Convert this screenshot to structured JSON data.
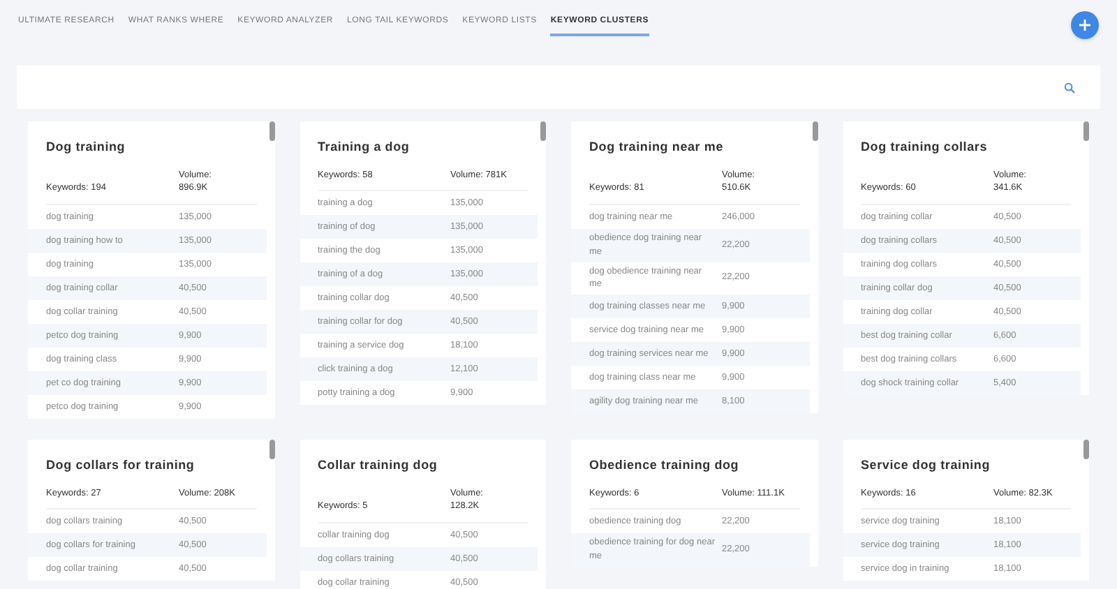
{
  "tabs": [
    {
      "label": "ULTIMATE RESEARCH",
      "selected": false
    },
    {
      "label": "WHAT RANKS WHERE",
      "selected": false
    },
    {
      "label": "KEYWORD ANALYZER",
      "selected": false
    },
    {
      "label": "LONG TAIL KEYWORDS",
      "selected": false
    },
    {
      "label": "KEYWORD LISTS",
      "selected": false
    },
    {
      "label": "KEYWORD CLUSTERS",
      "selected": true
    }
  ],
  "clusters": [
    {
      "title": "Dog training",
      "keywords": "Keywords: 194",
      "volume": "Volume: 896.9K",
      "scrollable": true,
      "rows": [
        [
          "dog training",
          "135,000"
        ],
        [
          "dog training how to",
          "135,000"
        ],
        [
          "dog training",
          "135,000"
        ],
        [
          "dog training collar",
          "40,500"
        ],
        [
          "dog collar training",
          "40,500"
        ],
        [
          "petco dog training",
          "9,900"
        ],
        [
          "dog training class",
          "9,900"
        ],
        [
          "pet co dog training",
          "9,900"
        ],
        [
          "petco dog training",
          "9,900"
        ]
      ]
    },
    {
      "title": "Training a dog",
      "keywords": "Keywords: 58",
      "volume": "Volume: 781K",
      "scrollable": true,
      "rows": [
        [
          "training a dog",
          "135,000"
        ],
        [
          "training of dog",
          "135,000"
        ],
        [
          "training the dog",
          "135,000"
        ],
        [
          "training of a dog",
          "135,000"
        ],
        [
          "training collar dog",
          "40,500"
        ],
        [
          "training collar for dog",
          "40,500"
        ],
        [
          "training a service dog",
          "18,100"
        ],
        [
          "click training a dog",
          "12,100"
        ],
        [
          "potty training a dog",
          "9,900"
        ]
      ]
    },
    {
      "title": "Dog training near me",
      "keywords": "Keywords: 81",
      "volume": "Volume: 510.6K",
      "scrollable": true,
      "rows": [
        [
          "dog training near me",
          "246,000"
        ],
        [
          "obedience dog training near me",
          "22,200"
        ],
        [
          "dog obedience training near me",
          "22,200"
        ],
        [
          "dog training classes near me",
          "9,900"
        ],
        [
          "service dog training near me",
          "9,900"
        ],
        [
          "dog training services near me",
          "9,900"
        ],
        [
          "dog training class near me",
          "9,900"
        ],
        [
          "agility dog training near me",
          "8,100"
        ]
      ]
    },
    {
      "title": "Dog training collars",
      "keywords": "Keywords: 60",
      "volume": "Volume: 341.6K",
      "scrollable": true,
      "rows": [
        [
          "dog training collar",
          "40,500"
        ],
        [
          "dog training collars",
          "40,500"
        ],
        [
          "training dog collars",
          "40,500"
        ],
        [
          "training collar dog",
          "40,500"
        ],
        [
          "training dog collar",
          "40,500"
        ],
        [
          "best dog training collar",
          "6,600"
        ],
        [
          "best dog training collars",
          "6,600"
        ],
        [
          "dog shock training collar",
          "5,400"
        ]
      ]
    },
    {
      "title": "Dog collars for training",
      "keywords": "Keywords: 27",
      "volume": "Volume: 208K",
      "scrollable": true,
      "rows": [
        [
          "dog collars training",
          "40,500"
        ],
        [
          "dog collars for training",
          "40,500"
        ],
        [
          "dog collar training",
          "40,500"
        ]
      ]
    },
    {
      "title": "Collar training dog",
      "keywords": "Keywords: 5",
      "volume": "Volume: 128.2K",
      "scrollable": false,
      "rows": [
        [
          "collar training dog",
          "40,500"
        ],
        [
          "dog collars training",
          "40,500"
        ],
        [
          "dog collar training",
          "40,500"
        ]
      ]
    },
    {
      "title": "Obedience training dog",
      "keywords": "Keywords: 6",
      "volume": "Volume: 111.1K",
      "scrollable": false,
      "rows": [
        [
          "obedience training dog",
          "22,200"
        ],
        [
          "obedience training for dog near me",
          "22,200"
        ]
      ]
    },
    {
      "title": "Service dog training",
      "keywords": "Keywords: 16",
      "volume": "Volume: 82.3K",
      "scrollable": true,
      "rows": [
        [
          "service dog training",
          "18,100"
        ],
        [
          "service dog training",
          "18,100"
        ],
        [
          "service dog in training",
          "18,100"
        ]
      ]
    }
  ]
}
